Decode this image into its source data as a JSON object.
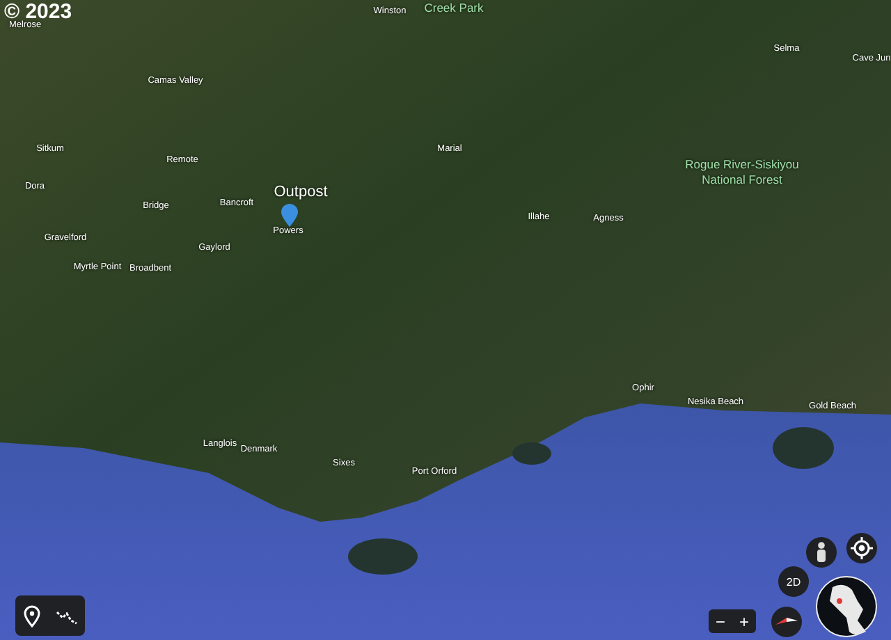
{
  "copyright": "© 2023",
  "map_labels": [
    {
      "kind": "town",
      "text": "Winston"
    },
    {
      "kind": "park",
      "text": "Creek Park"
    },
    {
      "kind": "town",
      "text": "Melrose"
    },
    {
      "kind": "town",
      "text": "Selma"
    },
    {
      "kind": "town",
      "text": "Cave Jun"
    },
    {
      "kind": "town",
      "text": "Camas Valley"
    },
    {
      "kind": "town",
      "text": "Sitkum"
    },
    {
      "kind": "town",
      "text": "Marial"
    },
    {
      "kind": "town",
      "text": "Remote"
    },
    {
      "kind": "park",
      "text": "Rogue River-Siskiyou National Forest"
    },
    {
      "kind": "town",
      "text": "Dora"
    },
    {
      "kind": "place",
      "text": "Outpost"
    },
    {
      "kind": "town",
      "text": "Bancroft"
    },
    {
      "kind": "town",
      "text": "Bridge"
    },
    {
      "kind": "town",
      "text": "Illahe"
    },
    {
      "kind": "town",
      "text": "Agness"
    },
    {
      "kind": "town",
      "text": "Powers"
    },
    {
      "kind": "town",
      "text": "Gravelford"
    },
    {
      "kind": "town",
      "text": "Gaylord"
    },
    {
      "kind": "town",
      "text": "Myrtle Point"
    },
    {
      "kind": "town",
      "text": "Broadbent"
    },
    {
      "kind": "town",
      "text": "Ophir"
    },
    {
      "kind": "town",
      "text": "Nesika Beach"
    },
    {
      "kind": "town",
      "text": "Gold Beach"
    },
    {
      "kind": "town",
      "text": "Langlois"
    },
    {
      "kind": "town",
      "text": "Denmark"
    },
    {
      "kind": "town",
      "text": "Sixes"
    },
    {
      "kind": "town",
      "text": "Port Orford"
    }
  ],
  "view_mode_button": "2D",
  "zoom_out": "−",
  "zoom_in": "+"
}
